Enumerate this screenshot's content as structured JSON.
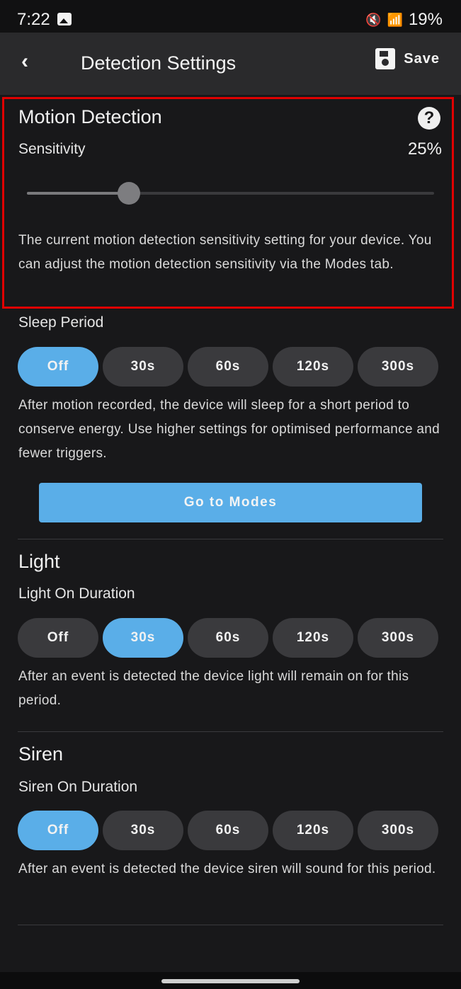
{
  "status_bar": {
    "time": "7:22",
    "battery": "19%",
    "icons": [
      "gallery-icon",
      "mute-icon",
      "wifi-icon",
      "signal-icon"
    ]
  },
  "header": {
    "title": "Detection Settings",
    "back_icon": "‹",
    "save_label": "Save"
  },
  "motion": {
    "title": "Motion Detection",
    "help_icon": "?",
    "sensitivity_label": "Sensitivity",
    "sensitivity_value": "25%",
    "slider_fraction": 0.25,
    "description": "The current motion detection sensitivity setting for your device. You can adjust the motion detection sensitivity via the Modes tab."
  },
  "sleep": {
    "label": "Sleep Period",
    "options": [
      "Off",
      "30s",
      "60s",
      "120s",
      "300s"
    ],
    "selected": "Off",
    "description": "After motion recorded, the device will sleep for a short period to conserve energy. Use higher settings for optimised performance and fewer triggers."
  },
  "go_to_modes_label": "Go to Modes",
  "light": {
    "title": "Light",
    "label": "Light On Duration",
    "options": [
      "Off",
      "30s",
      "60s",
      "120s",
      "300s"
    ],
    "selected": "30s",
    "description": "After an event is detected the device light will remain on for this period."
  },
  "siren": {
    "title": "Siren",
    "label": "Siren On Duration",
    "options": [
      "Off",
      "30s",
      "60s",
      "120s",
      "300s"
    ],
    "selected": "Off",
    "description": "After an event is detected the device siren will sound for this period."
  },
  "colors": {
    "accent": "#5aaee8",
    "background": "#18181a",
    "appbar": "#2a2a2c",
    "highlight": "#e00000"
  }
}
